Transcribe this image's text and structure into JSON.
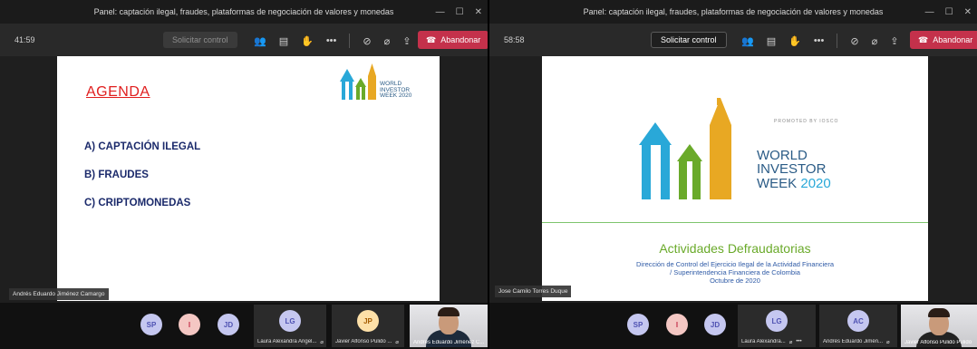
{
  "left_window": {
    "title": "Panel: captación ilegal, fraudes, plataformas de negociación de valores y monedas",
    "timer": "41:59",
    "control_button": "Solicitar control",
    "leave_button": "Abandonar",
    "slide": {
      "heading": "AGENDA",
      "items": [
        "A) CAPTACIÓN ILEGAL",
        "B) FRAUDES",
        "C) CRIPTOMONEDAS"
      ],
      "logo_lines": [
        "WORLD",
        "INVESTOR",
        "WEEK 2020"
      ]
    },
    "presenter_name": "Andrés Eduardo Jiménez Camargo",
    "participants": [
      {
        "initials": "SP",
        "color": "#4f52b2",
        "bg": "#c5c7f0"
      },
      {
        "initials": "I",
        "color": "#c4314b",
        "bg": "#f4c7c3"
      },
      {
        "initials": "JD",
        "color": "#4f52b2",
        "bg": "#c5c7f0"
      }
    ],
    "tiles": [
      {
        "initials": "LG",
        "name": "Laura Alexandra Angel...",
        "color": "#4f52b2",
        "bg": "#c5c7f0"
      },
      {
        "initials": "JP",
        "name": "Javier Alfonso Pulido ...",
        "color": "#a55b00",
        "bg": "#fde0a8"
      }
    ],
    "camera_name": "Andrés Eduardo Jiménez C..."
  },
  "right_window": {
    "title": "Panel: captación ilegal, fraudes, plataformas de negociación de valores y monedas",
    "timer": "58:58",
    "control_button": "Solicitar control",
    "leave_button": "Abandonar",
    "slide": {
      "promoted": "PROMOTED BY IOSCO",
      "logo_lines": [
        "WORLD",
        "INVESTOR",
        "WEEK"
      ],
      "logo_year": "2020",
      "title": "Actividades Defraudatorias",
      "subtitle_lines": [
        "Dirección de Control del Ejercicio Ilegal de la Actividad Financiera",
        "/ Superintendencia Financiera de Colombia",
        "Octubre de 2020"
      ]
    },
    "presenter_name": "Jose Camilo Torres Duque",
    "participants": [
      {
        "initials": "SP",
        "color": "#4f52b2",
        "bg": "#c5c7f0"
      },
      {
        "initials": "I",
        "color": "#c4314b",
        "bg": "#f4c7c3"
      },
      {
        "initials": "JD",
        "color": "#4f52b2",
        "bg": "#c5c7f0"
      }
    ],
    "tiles": [
      {
        "initials": "LG",
        "name": "Laura Alexandra...",
        "color": "#4f52b2",
        "bg": "#c5c7f0"
      },
      {
        "initials": "AC",
        "name": "Andrés Eduardo Jimén...",
        "color": "#4f52b2",
        "bg": "#c5c7f0"
      }
    ],
    "camera_name": "Javier Alfonso Pulido Pulido"
  },
  "colors": {
    "leave": "#c4314b",
    "logo_blue": "#29a8d8",
    "logo_green": "#6aaa2a",
    "logo_gold": "#e8a823",
    "logo_text": "#2a5b86"
  },
  "icons": [
    "participants-icon",
    "chat-icon",
    "raise-hand-icon",
    "more-icon",
    "camera-off-icon",
    "mic-off-icon",
    "share-icon",
    "phone-icon",
    "minimize-icon",
    "maximize-icon",
    "close-icon"
  ]
}
